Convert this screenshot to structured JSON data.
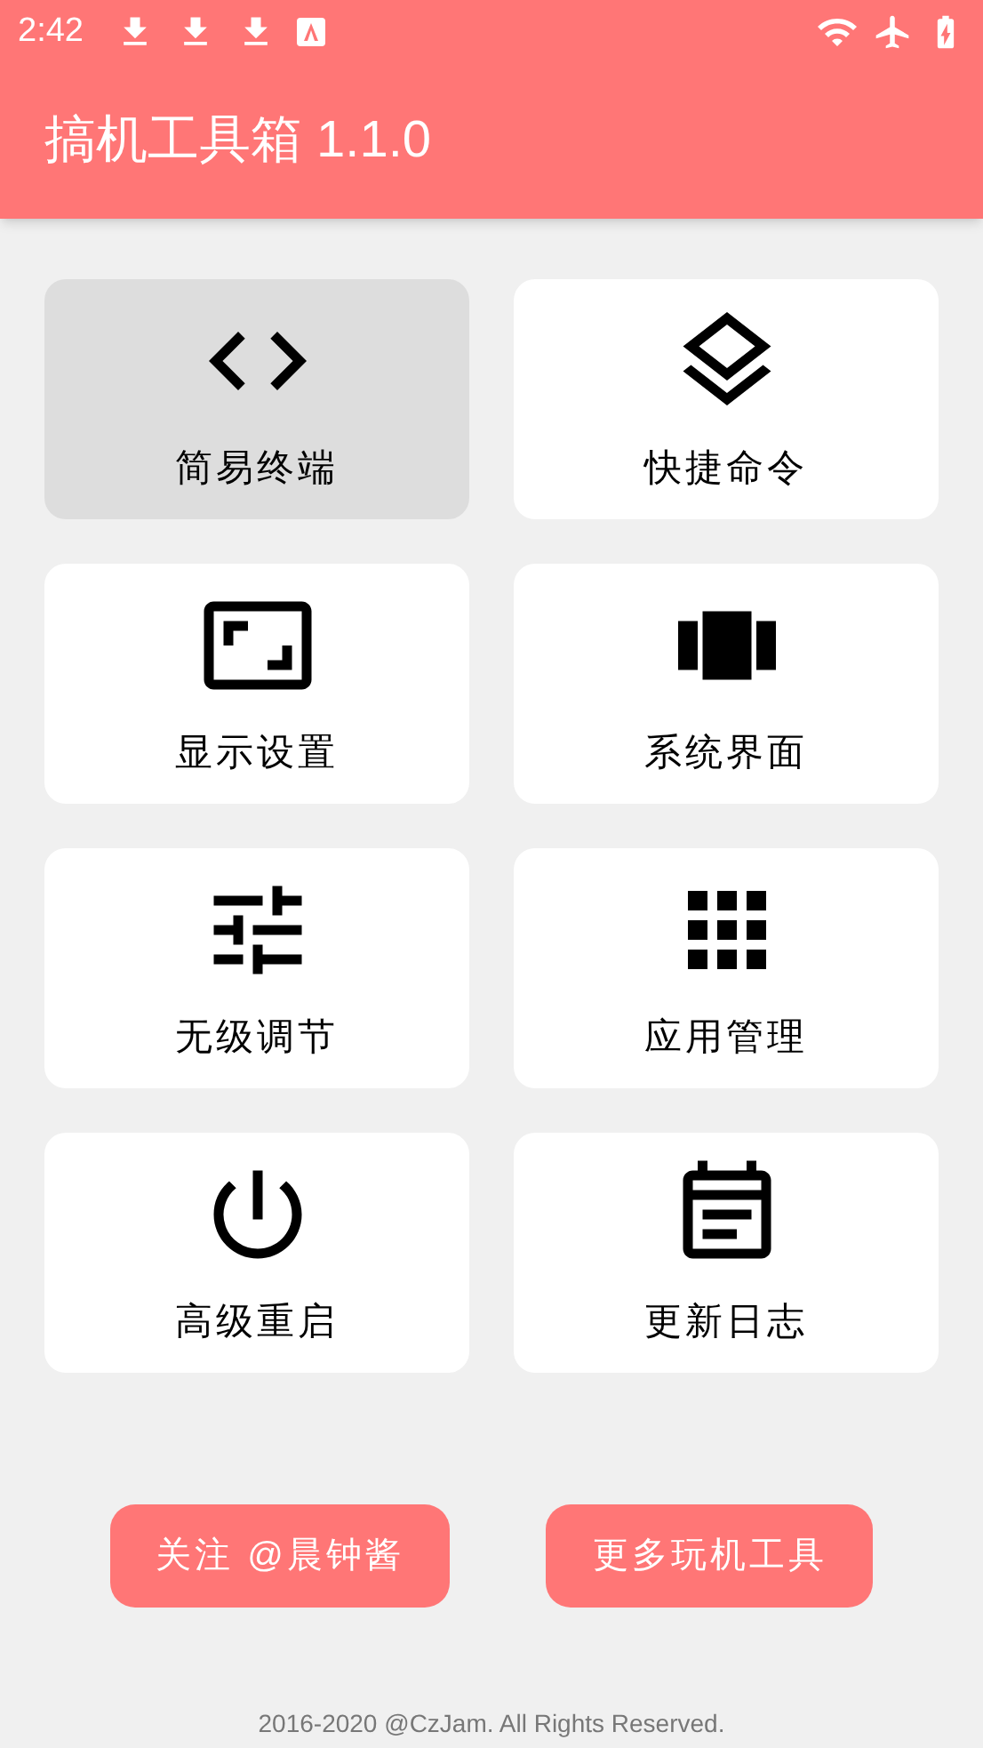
{
  "status_bar": {
    "time": "2:42"
  },
  "app_bar": {
    "title": "搞机工具箱 1.1.0"
  },
  "tools": [
    {
      "label": "简易终端",
      "selected": true
    },
    {
      "label": "快捷命令",
      "selected": false
    },
    {
      "label": "显示设置",
      "selected": false
    },
    {
      "label": "系统界面",
      "selected": false
    },
    {
      "label": "无级调节",
      "selected": false
    },
    {
      "label": "应用管理",
      "selected": false
    },
    {
      "label": "高级重启",
      "selected": false
    },
    {
      "label": "更新日志",
      "selected": false
    }
  ],
  "buttons": [
    "关注 @晨钟酱",
    "更多玩机工具"
  ],
  "footer": "2016-2020 @CzJam. All Rights Reserved."
}
